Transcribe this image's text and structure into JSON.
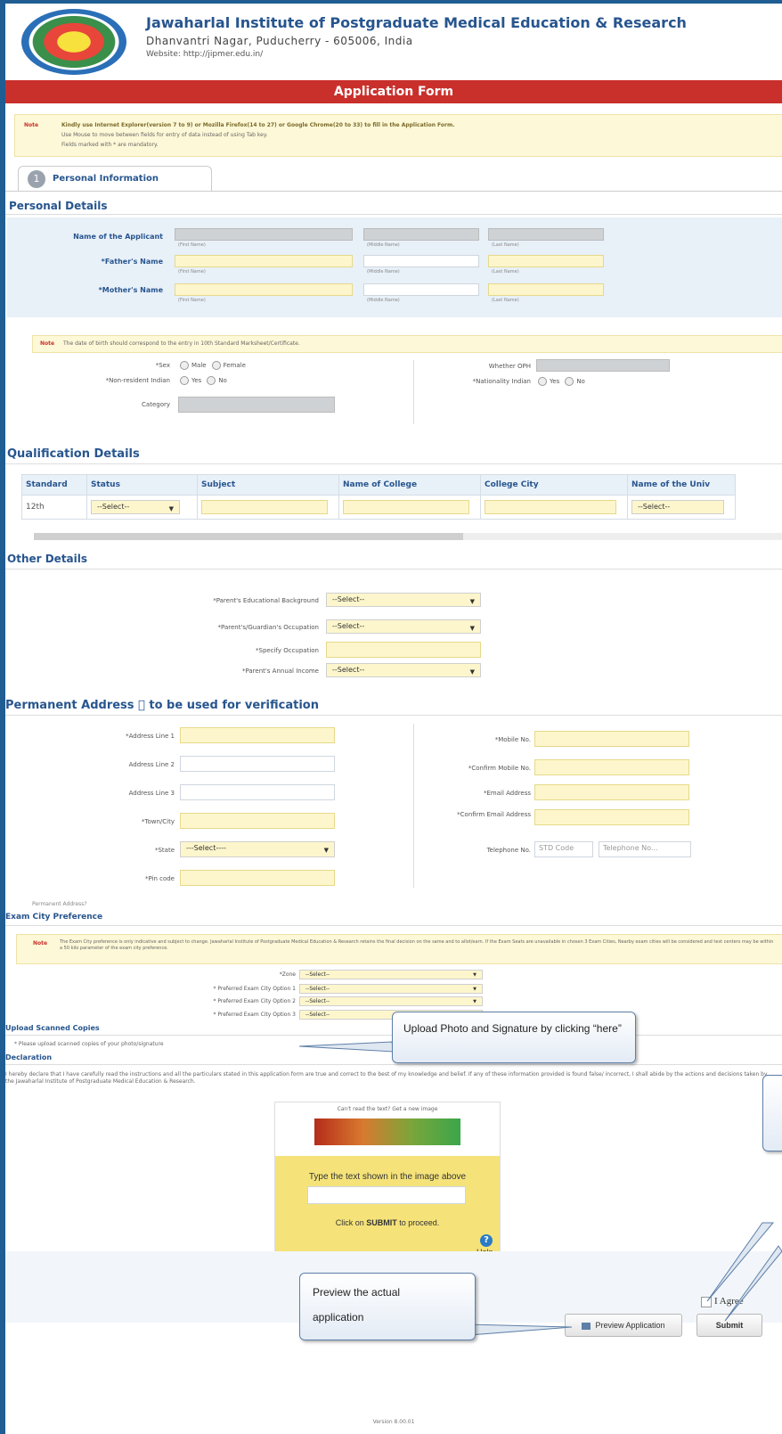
{
  "header": {
    "institute_name": "Jawaharlal Institute of Postgraduate Medical Education & Research",
    "address": "Dhanvantri Nagar, Puducherry - 605006, India",
    "website": "Website: http://jipmer.edu.in/",
    "form_title": "Application Form"
  },
  "note1": {
    "label": "Note",
    "line1": "Kindly use Internet Explorer(version 7 to 9) or Mozilla Firefox(14 to 27) or Google Chrome(20 to 33) to fill in the Application Form.",
    "line2": "Use Mouse to move between fields for entry of data instead of using Tab key.",
    "line3": "Fields marked with * are mandatory."
  },
  "tab": {
    "number": "1",
    "label": "Personal Information"
  },
  "personal": {
    "title": "Personal Details",
    "applicant_label": "Name of the Applicant",
    "father_label": "*Father's Name",
    "mother_label": "*Mother's Name",
    "hint_first": "(First Name)",
    "hint_middle": "(Middle Name)",
    "hint_last": "(Last Name)"
  },
  "note2": {
    "label": "Note",
    "text": "The date of birth should correspond to the entry in 10th Standard Marksheet/Certificate."
  },
  "demographics": {
    "sex_label": "*Sex",
    "sex_opt1": "Male",
    "sex_opt2": "Female",
    "nri_label": "*Non-resident Indian",
    "yes": "Yes",
    "no": "No",
    "category_label": "Category",
    "ophi_label": "Whether OPH",
    "nationality_label": "*Nationality Indian"
  },
  "qualification": {
    "title": "Qualification Details",
    "headers": [
      "Standard",
      "Status",
      "Subject",
      "Name of College",
      "College City",
      "Name of the Univ"
    ],
    "row": {
      "standard": "12th",
      "status": "--Select--",
      "university": "--Select--"
    }
  },
  "other": {
    "title": "Other Details",
    "edu_label": "*Parent's Educational Background",
    "occ_label": "*Parent's/Guardian's Occupation",
    "spec_label": "*Specify Occupation",
    "income_label": "*Parent's Annual Income",
    "select": "--Select--"
  },
  "address": {
    "title": "Permanent Address \u0000 to be used for verification",
    "line1": "*Address Line 1",
    "line2": "Address Line 2",
    "line3": "Address Line 3",
    "town": "*Town/City",
    "state": "*State",
    "state_value": "---Select----",
    "pin": "*Pin code",
    "mobile": "*Mobile No.",
    "confirm_mobile": "*Confirm Mobile No.",
    "email": "*Email Address",
    "confirm_email": "*Confirm Email Address",
    "telephone": "Telephone No.",
    "std_placeholder": "STD Code",
    "tel_placeholder": "Telephone No...",
    "footer": "Permanent Address?"
  },
  "exam_city": {
    "title": "Exam City Preference",
    "note_label": "Note",
    "note": "The Exam City preference is only indicative and subject to change. Jawaharlal Institute of Postgraduate Medical Education & Research retains the final decision on the same and to allot/earn. If the Exam Seats are unavailable in chosen 3 Exam Cities, Nearby exam cities will be considered and test centers may be within a 50 kilo parameter of the exam city preference.",
    "zone_label": "*Zone",
    "pref1": "* Preferred Exam City Option 1",
    "pref2": "* Preferred Exam City Option 2",
    "pref3": "* Preferred Exam City Option 3",
    "select": "--Select--"
  },
  "upload": {
    "title": "Upload Scanned Copies",
    "text": "* Please upload scanned copies of your photo/signature"
  },
  "declaration": {
    "title": "Declaration",
    "text": "I hereby declare that I have carefully read the instructions and all the particulars stated in this application form are true and correct to the best of my knowledge and belief. If any of these information provided is found false/ incorrect, I shall abide by the actions and decisions taken by the Jawaharlal Institute of Postgraduate Medical Education & Research."
  },
  "captcha": {
    "cant_read": "Can't read the text? Get a new image",
    "type_text": "Type the text shown in the image above",
    "click_text_pre": "Click on ",
    "click_text_bold": "SUBMIT",
    "click_text_post": " to proceed.",
    "help": "Help"
  },
  "callouts": {
    "upload": "Upload Photo and Signature by clicking “here”",
    "preview_line1": "Preview the actual",
    "preview_line2": "application"
  },
  "actions": {
    "agree": "I Agree",
    "preview": "Preview Application",
    "submit": "Submit"
  },
  "version": "Version 8.00.01"
}
